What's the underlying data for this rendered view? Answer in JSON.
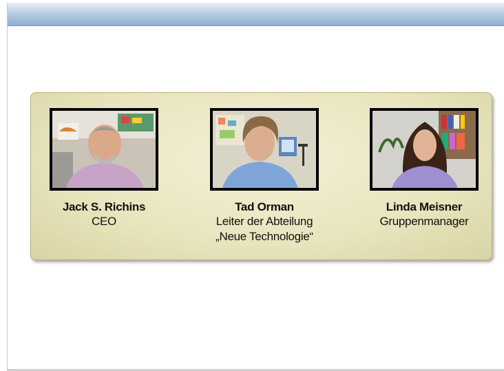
{
  "people": [
    {
      "name": "Jack S. Richins",
      "role_lines": [
        "CEO"
      ]
    },
    {
      "name": "Tad Orman",
      "role_lines": [
        "Leiter der Abteilung",
        "„Neue Technologie“"
      ]
    },
    {
      "name": "Linda Meisner",
      "role_lines": [
        "Gruppenmanager"
      ]
    }
  ],
  "colors": {
    "header_top": "#e9f0f8",
    "header_bottom": "#8eaed2",
    "panel_fill": "#e8e4bd",
    "panel_border": "#b8b27a",
    "photo_frame": "#000000"
  }
}
